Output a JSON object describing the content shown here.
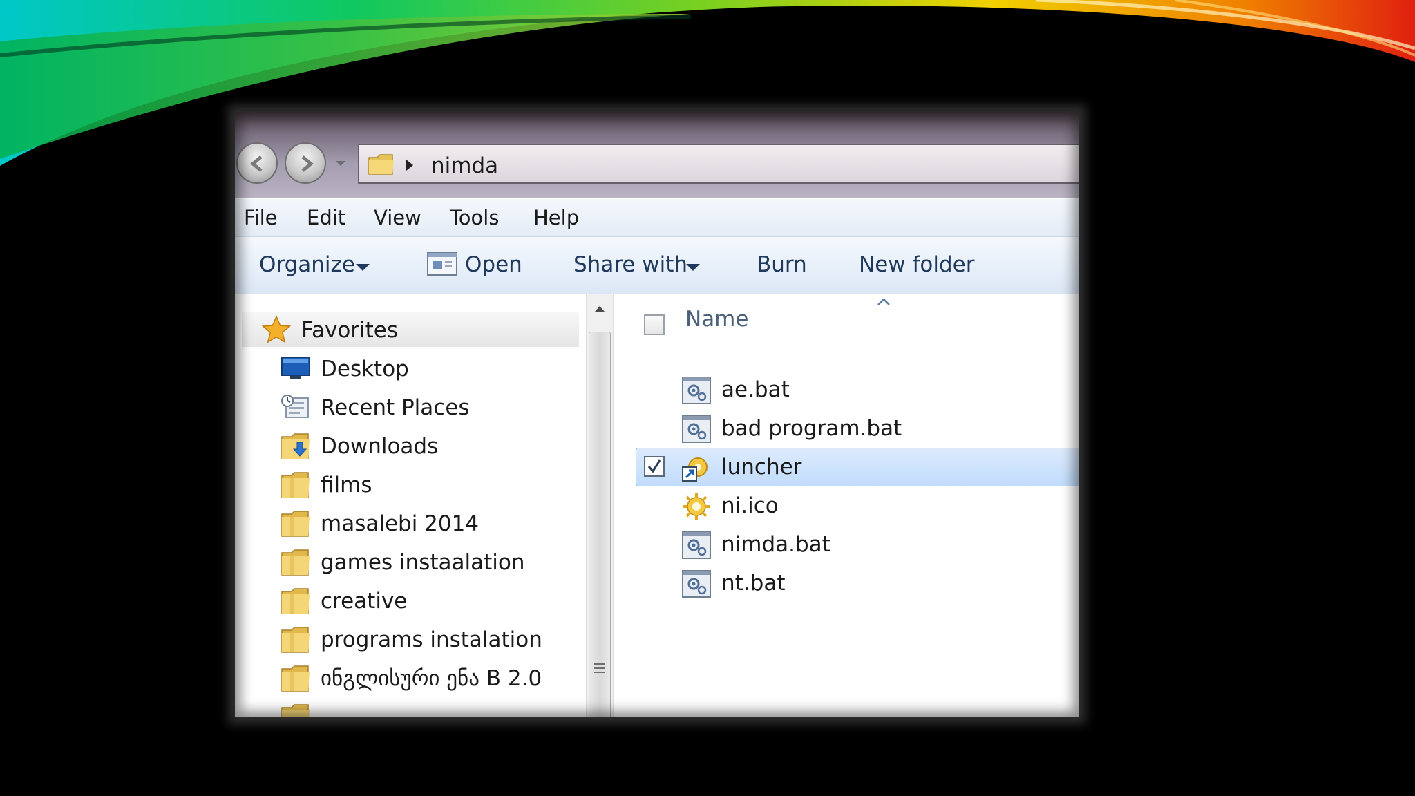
{
  "address": {
    "current_folder": "nimda"
  },
  "menu": [
    "File",
    "Edit",
    "View",
    "Tools",
    "Help"
  ],
  "toolbar": {
    "organize": "Organize",
    "open": "Open",
    "share_with": "Share with",
    "burn": "Burn",
    "new_folder": "New folder"
  },
  "navpane": {
    "favorites": "Favorites",
    "items": [
      {
        "label": "Desktop",
        "icon": "desktop-icon"
      },
      {
        "label": "Recent Places",
        "icon": "recent-places-icon"
      },
      {
        "label": "Downloads",
        "icon": "downloads-folder-icon"
      },
      {
        "label": "films",
        "icon": "folder-icon"
      },
      {
        "label": "masalebi 2014",
        "icon": "folder-icon"
      },
      {
        "label": "games instaalation",
        "icon": "folder-icon"
      },
      {
        "label": "creative",
        "icon": "folder-icon"
      },
      {
        "label": "programs instalation",
        "icon": "folder-icon"
      },
      {
        "label": "ინგლისური ენა B 2.0",
        "icon": "folder-icon"
      }
    ]
  },
  "filepane": {
    "column_name": "Name",
    "files": [
      {
        "name": "ae.bat",
        "icon": "batch-file-icon",
        "selected": false
      },
      {
        "name": "bad program.bat",
        "icon": "batch-file-icon",
        "selected": false
      },
      {
        "name": "luncher",
        "icon": "shortcut-icon",
        "selected": true
      },
      {
        "name": "ni.ico",
        "icon": "ico-file-icon",
        "selected": false
      },
      {
        "name": "nimda.bat",
        "icon": "batch-file-icon",
        "selected": false
      },
      {
        "name": "nt.bat",
        "icon": "batch-file-icon",
        "selected": false
      }
    ]
  },
  "colors": {
    "toolbar_text": "#1e395b",
    "selection": "#c1dcfc",
    "selection_border": "#7da2ce"
  }
}
